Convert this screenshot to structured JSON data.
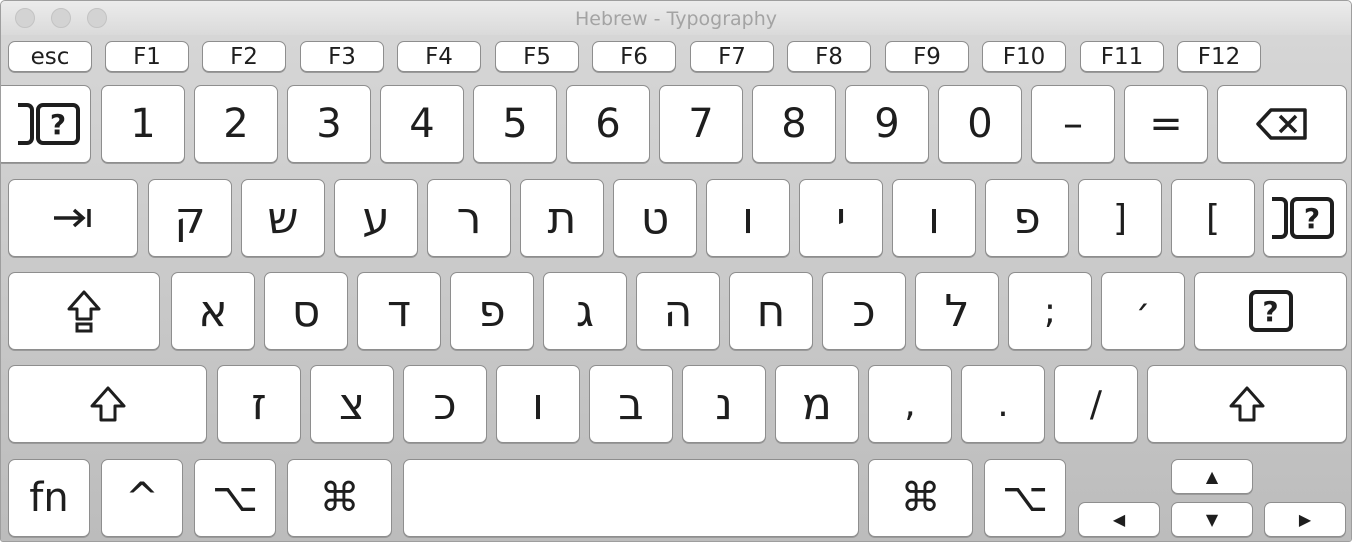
{
  "window": {
    "title": "Hebrew - Typography"
  },
  "function_row": [
    "esc",
    "F1",
    "F2",
    "F3",
    "F4",
    "F5",
    "F6",
    "F7",
    "F8",
    "F9",
    "F10",
    "F11",
    "F12"
  ],
  "number_row": {
    "left_key_glyph": "?",
    "keys": [
      "1",
      "2",
      "3",
      "4",
      "5",
      "6",
      "7",
      "8",
      "9",
      "0",
      "–",
      "="
    ]
  },
  "top_row": {
    "keys": [
      "ק",
      "ש",
      "ע",
      "ר",
      "ת",
      "ט",
      "ו",
      "י",
      "ו",
      "פ",
      "]",
      "["
    ],
    "right_key_glyph": "?"
  },
  "home_row": {
    "keys": [
      "א",
      "ס",
      "ד",
      "פ",
      "ג",
      "ה",
      "ח",
      "כ",
      "ל",
      ";",
      "׳"
    ],
    "right_key_glyph": "?"
  },
  "bottom_row": {
    "keys": [
      "ז",
      "צ",
      "כ",
      "ו",
      "ב",
      "נ",
      "מ",
      ",",
      ".",
      "/"
    ]
  },
  "modifier_row": {
    "fn": "fn",
    "control": "^",
    "option": "⌥",
    "command": "⌘"
  },
  "arrows": {
    "up": "▲",
    "down": "▼",
    "left": "◀",
    "right": "▶"
  }
}
